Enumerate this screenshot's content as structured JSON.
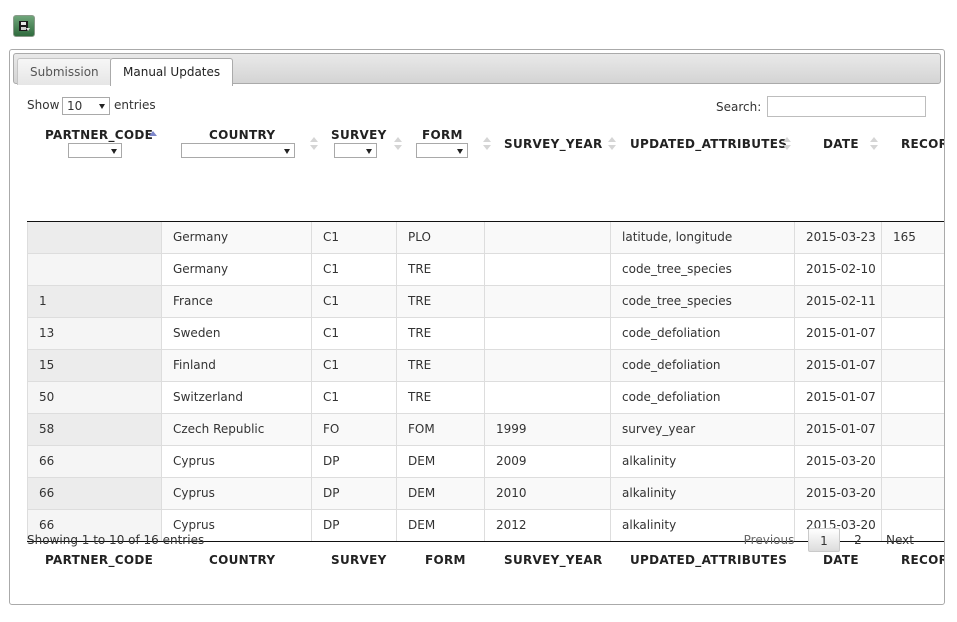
{
  "tabs": [
    {
      "label": "Submission",
      "active": false
    },
    {
      "label": "Manual Updates",
      "active": true
    }
  ],
  "length_control": {
    "show_label": "Show",
    "value": "10",
    "entries_label": "entries"
  },
  "search": {
    "label": "Search:",
    "value": ""
  },
  "columns": [
    "PARTNER_CODE",
    "COUNTRY",
    "SURVEY",
    "FORM",
    "SURVEY_YEAR",
    "UPDATED_ATTRIBUTES",
    "DATE",
    "RECORDS"
  ],
  "sorted_column": "PARTNER_CODE",
  "rows": [
    {
      "partner_code": "",
      "country": "Germany",
      "survey": "C1",
      "form": "PLO",
      "survey_year": "",
      "updated_attributes": "latitude, longitude",
      "date": "2015-03-23",
      "records": "165"
    },
    {
      "partner_code": "",
      "country": "Germany",
      "survey": "C1",
      "form": "TRE",
      "survey_year": "",
      "updated_attributes": "code_tree_species",
      "date": "2015-02-10",
      "records": ""
    },
    {
      "partner_code": "1",
      "country": "France",
      "survey": "C1",
      "form": "TRE",
      "survey_year": "",
      "updated_attributes": "code_tree_species",
      "date": "2015-02-11",
      "records": ""
    },
    {
      "partner_code": "13",
      "country": "Sweden",
      "survey": "C1",
      "form": "TRE",
      "survey_year": "",
      "updated_attributes": "code_defoliation",
      "date": "2015-01-07",
      "records": ""
    },
    {
      "partner_code": "15",
      "country": "Finland",
      "survey": "C1",
      "form": "TRE",
      "survey_year": "",
      "updated_attributes": "code_defoliation",
      "date": "2015-01-07",
      "records": ""
    },
    {
      "partner_code": "50",
      "country": "Switzerland",
      "survey": "C1",
      "form": "TRE",
      "survey_year": "",
      "updated_attributes": "code_defoliation",
      "date": "2015-01-07",
      "records": ""
    },
    {
      "partner_code": "58",
      "country": "Czech Republic",
      "survey": "FO",
      "form": "FOM",
      "survey_year": "1999",
      "updated_attributes": "survey_year",
      "date": "2015-01-07",
      "records": ""
    },
    {
      "partner_code": "66",
      "country": "Cyprus",
      "survey": "DP",
      "form": "DEM",
      "survey_year": "2009",
      "updated_attributes": "alkalinity",
      "date": "2015-03-20",
      "records": ""
    },
    {
      "partner_code": "66",
      "country": "Cyprus",
      "survey": "DP",
      "form": "DEM",
      "survey_year": "2010",
      "updated_attributes": "alkalinity",
      "date": "2015-03-20",
      "records": ""
    },
    {
      "partner_code": "66",
      "country": "Cyprus",
      "survey": "DP",
      "form": "DEM",
      "survey_year": "2012",
      "updated_attributes": "alkalinity",
      "date": "2015-03-20",
      "records": ""
    }
  ],
  "info": "Showing 1 to 10 of 16 entries",
  "pagination": {
    "previous": "Previous",
    "pages": [
      "1",
      "2"
    ],
    "current": "1",
    "next": "Next"
  },
  "icons": {
    "toolbar": "save-export-icon"
  },
  "colors": {
    "sort_active": "#7d86c9",
    "save_button": "#2f6b3d"
  }
}
